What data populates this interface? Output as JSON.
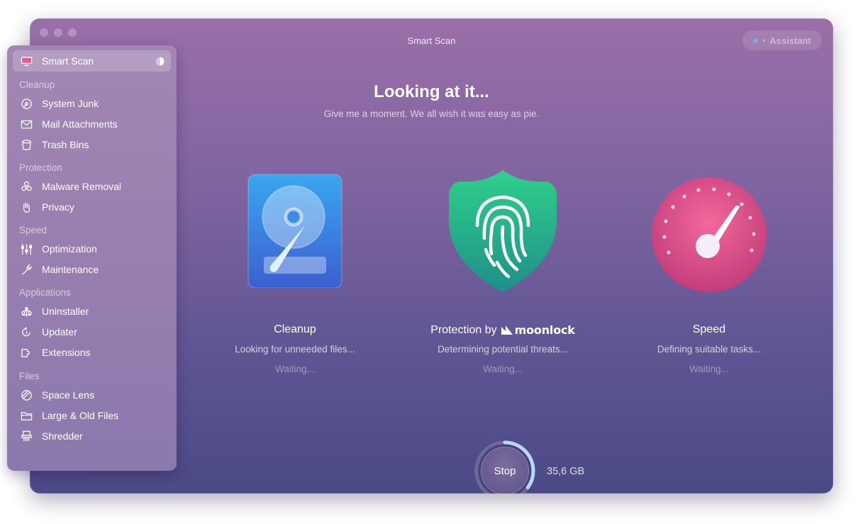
{
  "window": {
    "title": "Smart Scan",
    "assistant_label": "Assistant"
  },
  "sidebar": {
    "active": {
      "label": "Smart Scan",
      "icon": "monitor-icon"
    },
    "sections": [
      {
        "title": "Cleanup",
        "items": [
          {
            "label": "System Junk",
            "icon": "disk-icon"
          },
          {
            "label": "Mail Attachments",
            "icon": "envelope-icon"
          },
          {
            "label": "Trash Bins",
            "icon": "trash-icon"
          }
        ]
      },
      {
        "title": "Protection",
        "items": [
          {
            "label": "Malware Removal",
            "icon": "biohazard-icon"
          },
          {
            "label": "Privacy",
            "icon": "hand-icon"
          }
        ]
      },
      {
        "title": "Speed",
        "items": [
          {
            "label": "Optimization",
            "icon": "sliders-icon"
          },
          {
            "label": "Maintenance",
            "icon": "wrench-icon"
          }
        ]
      },
      {
        "title": "Applications",
        "items": [
          {
            "label": "Uninstaller",
            "icon": "uninstaller-icon"
          },
          {
            "label": "Updater",
            "icon": "updater-icon"
          },
          {
            "label": "Extensions",
            "icon": "extensions-icon"
          }
        ]
      },
      {
        "title": "Files",
        "items": [
          {
            "label": "Space Lens",
            "icon": "lens-icon"
          },
          {
            "label": "Large & Old Files",
            "icon": "folder-icon"
          },
          {
            "label": "Shredder",
            "icon": "shredder-icon"
          }
        ]
      }
    ]
  },
  "main": {
    "headline": "Looking at it...",
    "subheadline": "Give me a moment. We all wish it was easy as pie.",
    "modules": [
      {
        "title": "Cleanup",
        "description": "Looking for unneeded files...",
        "status": "Waiting...",
        "icon": "hard-drive-icon"
      },
      {
        "title": "Protection by",
        "brand": "moonlock",
        "description": "Determining potential threats...",
        "status": "Waiting...",
        "icon": "fingerprint-shield-icon"
      },
      {
        "title": "Speed",
        "description": "Defining suitable tasks...",
        "status": "Waiting...",
        "icon": "speedometer-icon"
      }
    ],
    "stop_label": "Stop",
    "scanned_size": "35,6 GB",
    "scan_progress": 0.35
  },
  "colors": {
    "accent_blue": "#5fb7ff",
    "shield_green": "#2fc28a",
    "speed_pink": "#e8588f"
  }
}
